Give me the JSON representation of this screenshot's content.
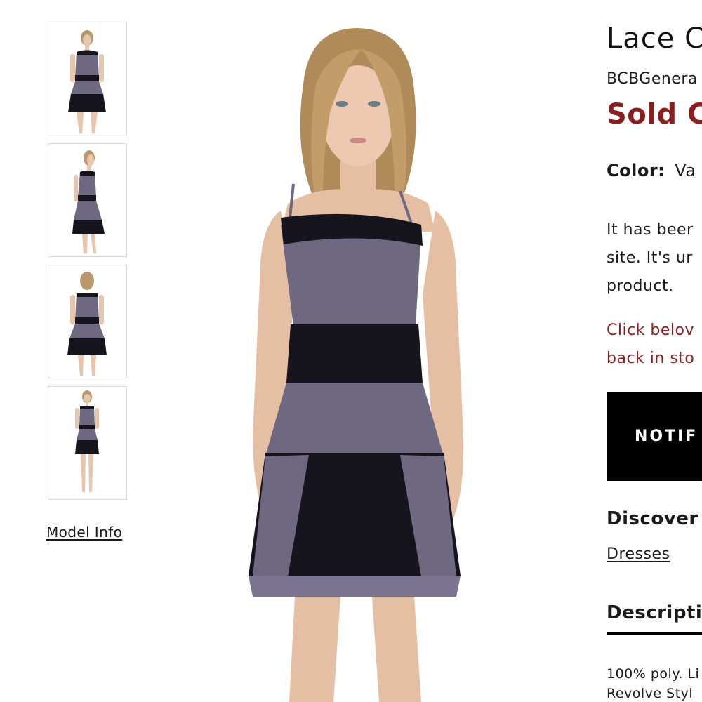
{
  "product": {
    "title": "Lace C",
    "brand": "BCBGenera",
    "status": "Sold C",
    "color_label": "Color:",
    "color_value": "Va",
    "unavailable_line1": "It has beer",
    "unavailable_line2": "site. It's ur",
    "unavailable_line3": "product.",
    "notify_line1": "Click belov",
    "notify_line2": "back in sto",
    "notify_button": "NOTIF",
    "discover_heading": "Discover",
    "category_link": "Dresses",
    "description_tab": "Descripti",
    "description_line1": "100% poly. Li",
    "description_line2": "Revolve Styl"
  },
  "gallery": {
    "model_info_link": "Model Info",
    "thumbnails": [
      "front view",
      "side view",
      "back view",
      "full length view"
    ]
  },
  "colors": {
    "sold_out": "#8b1e1e",
    "dress_purple": "#6e6880",
    "lace_black": "#16141c",
    "button_bg": "#000000"
  }
}
